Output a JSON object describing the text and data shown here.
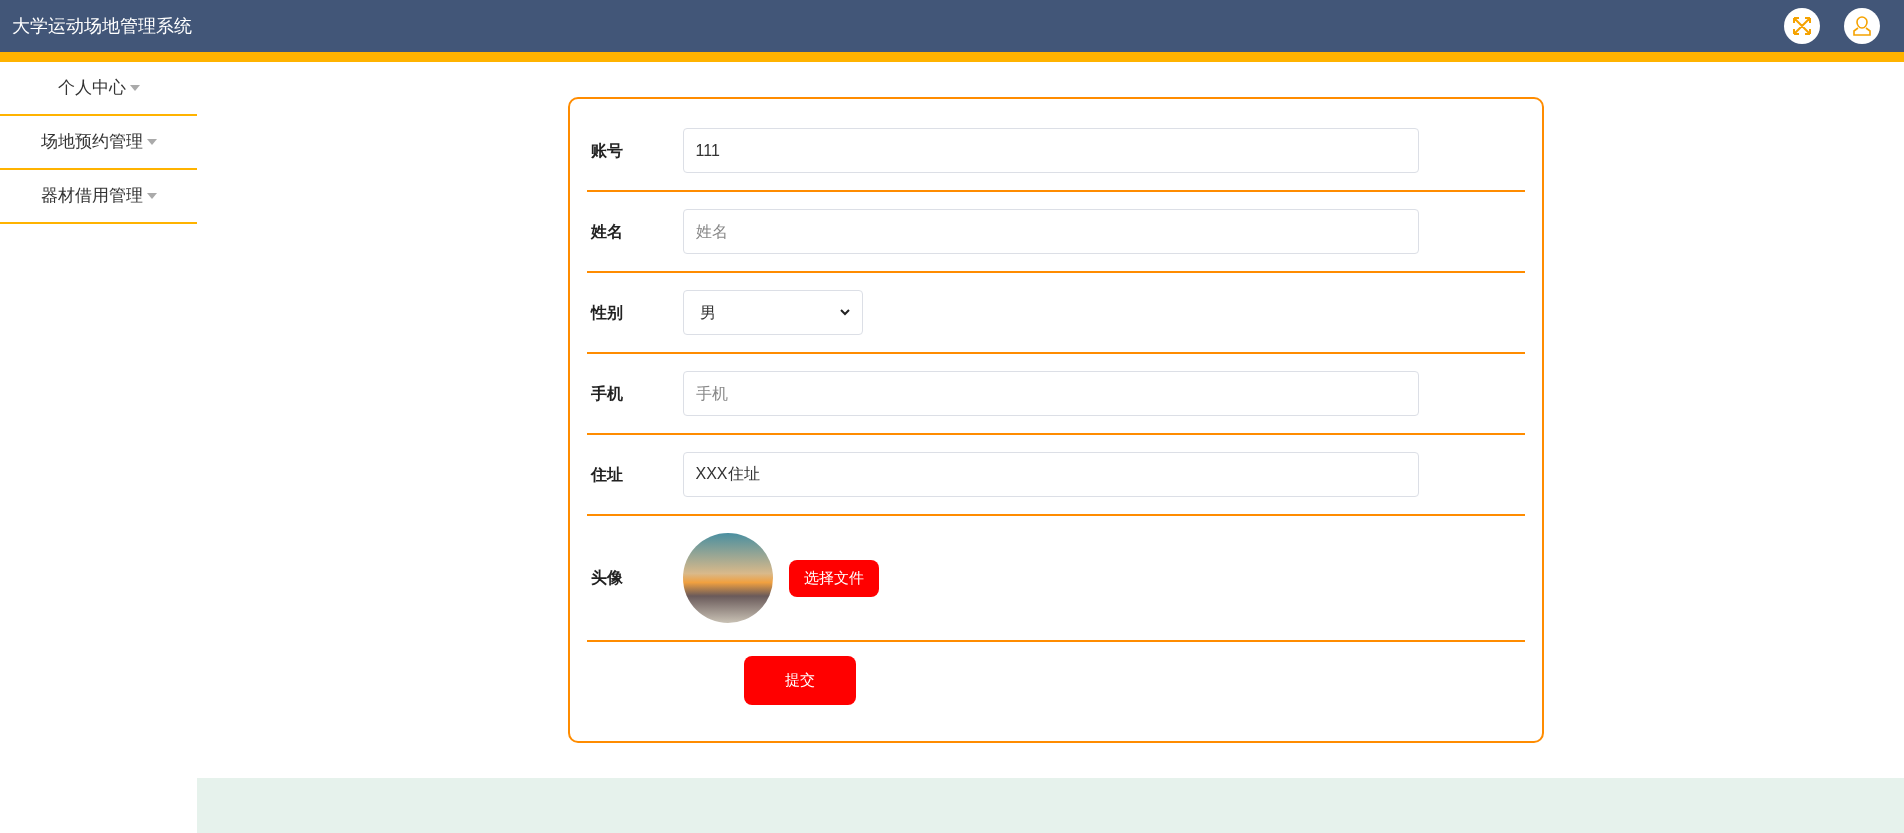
{
  "header": {
    "title": "大学运动场地管理系统"
  },
  "sidebar": {
    "items": [
      {
        "label": "个人中心"
      },
      {
        "label": "场地预约管理"
      },
      {
        "label": "器材借用管理"
      }
    ]
  },
  "form": {
    "fields": [
      {
        "kind": "text",
        "label": "账号",
        "value": "111"
      },
      {
        "kind": "text",
        "label": "姓名",
        "placeholder": "姓名"
      },
      {
        "kind": "select",
        "label": "性别",
        "value": "男"
      },
      {
        "kind": "text",
        "label": "手机",
        "placeholder": "手机"
      },
      {
        "kind": "text",
        "label": "住址",
        "value": "XXX住址"
      },
      {
        "kind": "file",
        "label": "头像",
        "button": "选择文件"
      }
    ],
    "submit": "提交"
  }
}
